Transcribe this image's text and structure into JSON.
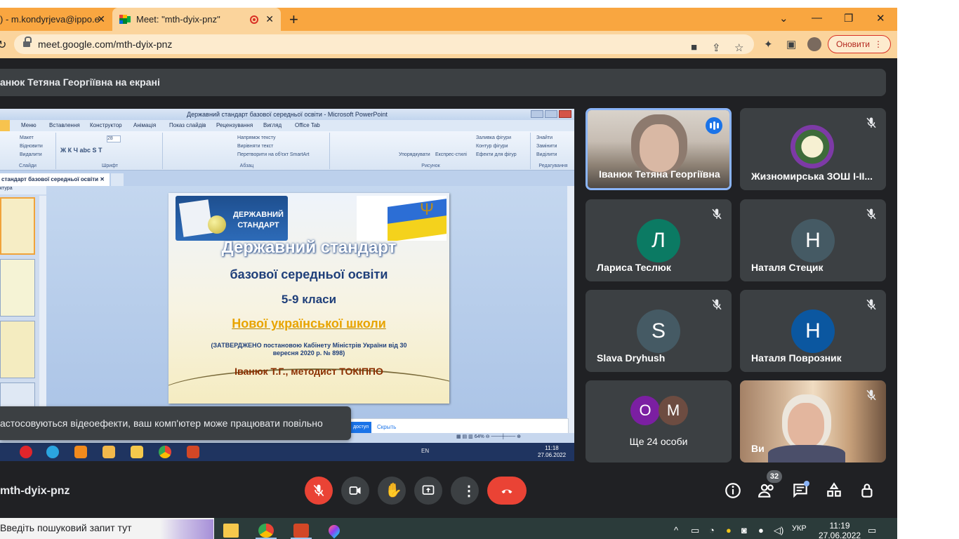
{
  "browser": {
    "tabs": [
      {
        "label": ") - m.kondyrjeva@ippo.e",
        "active": false
      },
      {
        "label": "Meet: \"mth-dyix-pnz\"",
        "active": true,
        "recording": true
      }
    ],
    "url": "meet.google.com/mth-dyix-pnz",
    "update_button": "Оновити"
  },
  "meet": {
    "presenting_banner": "анюк Тетяна Георгіївна на екрані",
    "effects_toast": "астосовуються відеоефекти, ваш комп'ютер може працювати повільно",
    "meeting_code": "mth-dyix-pnz",
    "participants_count": "32",
    "tiles": [
      {
        "name": "Іванюк Тетяна Георгіївна",
        "type": "video",
        "speaking": true
      },
      {
        "name": "Жизномирська ЗОШ І-ІІ...",
        "type": "logo",
        "muted": true
      },
      {
        "name": "Лариса Теслюк",
        "initial": "Л",
        "color": "#0b7a63",
        "muted": true
      },
      {
        "name": "Наталя Стецик",
        "initial": "Н",
        "color": "#455a64",
        "muted": true
      },
      {
        "name": "Slava Dryhush",
        "initial": "S",
        "color": "#455a64",
        "muted": true
      },
      {
        "name": "Наталя Поврозник",
        "initial": "Н",
        "color": "#0b57a0",
        "muted": true
      },
      {
        "name": "Ще 24 особи",
        "initials": [
          "О",
          "М"
        ],
        "colors": [
          "#7b1fa2",
          "#6d4c41"
        ]
      },
      {
        "name": "Ви",
        "type": "self-video",
        "muted": true
      }
    ]
  },
  "shared_screen": {
    "window_title": "Державний стандарт базової середньої освіти - Microsoft PowerPoint",
    "menu": [
      "Меню",
      "Вставлення",
      "Конструктор",
      "Анімація",
      "Показ слайдів",
      "Рецензування",
      "Вигляд",
      "Office Tab"
    ],
    "ribbon_groups": [
      "Слайди",
      "Шрифт",
      "Абзац",
      "Рисунок",
      "Редагування"
    ],
    "ribbon_items": {
      "slides": [
        "Макет",
        "Відновити",
        "Видалити"
      ],
      "paragraph": [
        "Напрямок тексту",
        "Вирівняти текст",
        "Перетворити на об'єкт SmartArt"
      ],
      "drawing": [
        "Упорядкувати",
        "Експрес-стилі",
        "Заливка фігури",
        "Контур фігури",
        "Ефекти для фігур"
      ],
      "editing": [
        "Знайти",
        "Замінити",
        "Виділити"
      ]
    },
    "font_size": "28",
    "doc_tab": "стандарт базової середньої освіти",
    "outline_tab": "ктура",
    "slide": {
      "badge_text": "ДЕРЖАВНИЙ СТАНДАРТ",
      "title": "Державний стандарт",
      "line1": "базової середньої освіти",
      "line2": "5-9 класи",
      "line3": "Нової української школи",
      "line4": "(ЗАТВЕРДЖЕНО постановою Кабінету Міністрів України від 30 вересня 2020 р. № 898)",
      "line5": "Іванюк Т.Г., методист ТОКІППО"
    },
    "zoom": "64%",
    "dialog_primary": "доступ",
    "dialog_secondary": "Скрыть",
    "tray_lang": "EN",
    "clock_time": "11:18",
    "clock_date": "27.06.2022"
  },
  "taskbar": {
    "search_placeholder": "Введіть пошуковий запит тут",
    "lang": "УКР",
    "time": "11:19",
    "date": "27.06.2022"
  }
}
